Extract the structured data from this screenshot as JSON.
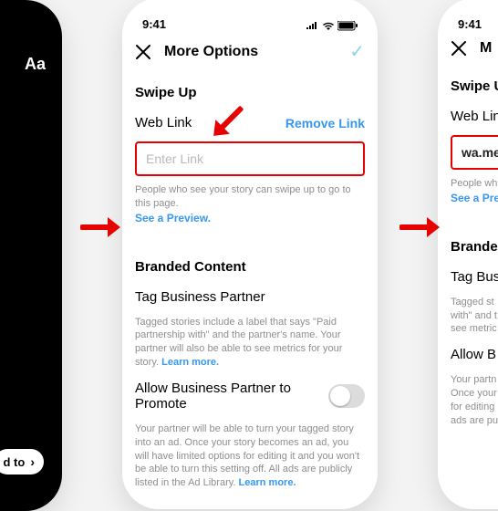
{
  "status": {
    "time": "9:41"
  },
  "header": {
    "title": "More Options"
  },
  "swipe": {
    "section_label": "Swipe Up",
    "web_link_label": "Web Link",
    "remove_label": "Remove Link",
    "placeholder": "Enter Link",
    "filled_value": "wa.me/",
    "caption": "People who see your story can swipe up to go to this page.",
    "preview_label": "See a Preview."
  },
  "branded": {
    "section_label": "Branded Content",
    "tag_label": "Tag Business Partner",
    "tag_caption": "Tagged stories include a label that says \"Paid partnership with\" and the partner's name. Your partner will also be able to see metrics for your story.",
    "allow_label": "Allow Business Partner to Promote",
    "allow_caption": "Your partner will be able to turn your tagged story into an ad. Once your story becomes an ad, you will have limited options for editing it and you won't be able to turn this setting off. All ads are publicly listed in the Ad Library.",
    "learn_more": "Learn more."
  },
  "left": {
    "text_tool": "Aa",
    "cta": "d to"
  },
  "right_header_initial": "M"
}
